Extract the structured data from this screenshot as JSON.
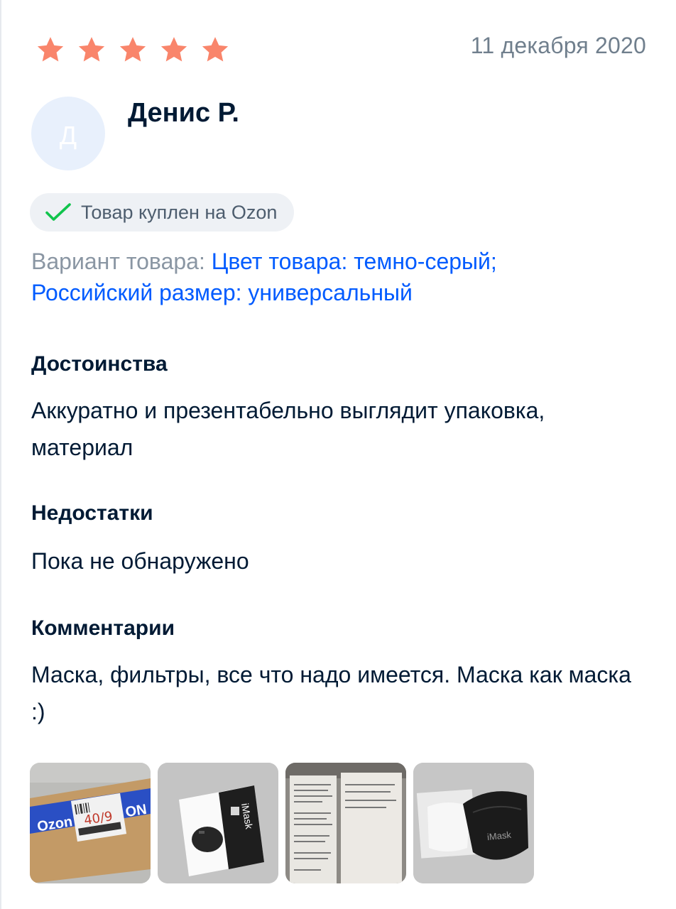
{
  "review": {
    "rating": 5,
    "rating_max": 5,
    "star_color": "#f9856b",
    "date": "11 декабря 2020",
    "author": {
      "avatar_letter": "Д",
      "name": "Денис Р."
    },
    "purchase_badge": {
      "icon": "check-icon",
      "icon_color": "#10c44c",
      "text": "Товар куплен на Ozon"
    },
    "variant": {
      "label": "Вариант товара:",
      "value_line1": "Цвет товара: темно-серый;",
      "value_line2": "Российский размер: универсальный"
    },
    "pros": {
      "title": "Достоинства",
      "text": "Аккуратно и презентабельно выглядит упаковка, материал"
    },
    "cons": {
      "title": "Недостатки",
      "text": "Пока не обнаружено"
    },
    "comments": {
      "title": "Комментарии",
      "text": "Маска, фильтры, все что надо имеется. Маска как маска :)"
    },
    "photos": [
      {
        "name": "review-photo-parcel",
        "label": "Ozon",
        "note": "40/9"
      },
      {
        "name": "review-photo-box",
        "label": "iMask"
      },
      {
        "name": "review-photo-instructions"
      },
      {
        "name": "review-photo-masks",
        "label": "iMask"
      }
    ],
    "accent_color": "#005bff"
  }
}
